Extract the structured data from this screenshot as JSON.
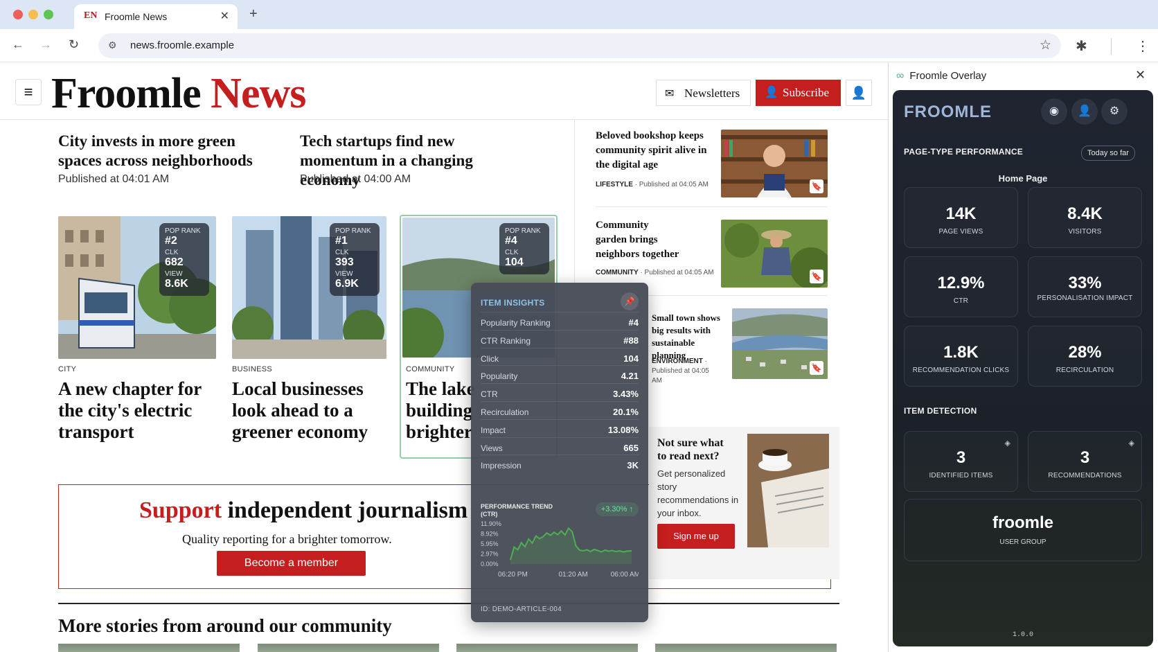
{
  "browser": {
    "tab_favicon": "EN",
    "tab_title": "Froomle News",
    "url": "news.froomle.example",
    "icons": [
      "back-icon",
      "forward-icon",
      "reload-icon",
      "site-settings-icon",
      "star-icon",
      "extensions-icon",
      "menu-icon"
    ]
  },
  "site": {
    "logo_main": "Froomle ",
    "logo_accent": "News",
    "newsletters": "Newsletters",
    "subscribe": "Subscribe",
    "accent": "#c41e1e"
  },
  "top_stories": [
    {
      "title": "City invests in more green spaces across neighborhoods",
      "published": "Published at 04:01 AM"
    },
    {
      "title": "Tech startups find new momentum in a changing economy",
      "published": "Published at 04:00 AM"
    }
  ],
  "cards": [
    {
      "category": "CITY",
      "title": "A new chapter for the city's electric transport",
      "pop_label": "POP RANK",
      "pop": "#2",
      "clk_label": "CLK",
      "clk": "682",
      "view_label": "VIEW",
      "view": "8.6K"
    },
    {
      "category": "BUSINESS",
      "title": "Local businesses look ahead to a greener economy",
      "pop_label": "POP RANK",
      "pop": "#1",
      "clk_label": "CLK",
      "clk": "393",
      "view_label": "VIEW",
      "view": "6.9K"
    },
    {
      "category": "COMMUNITY",
      "title": "The lake building brighter f",
      "pop_label": "POP RANK",
      "pop": "#4",
      "clk_label": "CLK",
      "clk": "104",
      "view_label": "VIEW",
      "view": ""
    }
  ],
  "side_stories": [
    {
      "title": "Beloved bookshop keeps community spirit alive in the digital age",
      "category": "LIFESTYLE",
      "published": " · Published at 04:05 AM"
    },
    {
      "title": "Community garden brings neighbors together",
      "category": "COMMUNITY",
      "published": " · Published at 04:05 AM"
    },
    {
      "title": "Small town shows big results with sustainable planning",
      "category": "ENVIRONMENT",
      "category_suffix": " ·",
      "published": "Published at 04:05 AM"
    }
  ],
  "newsletter_box": {
    "title": "Not sure what to read next?",
    "text": "Get personalized story recommendations in your inbox.",
    "button": "Sign me up"
  },
  "support": {
    "accent_word": "Support",
    "rest": " independent journalism",
    "subtitle": "Quality reporting for a brighter tomorrow.",
    "button": "Become a member"
  },
  "more_heading": "More stories from around our community",
  "insights": {
    "title": "ITEM INSIGHTS",
    "rows": [
      {
        "label": "Popularity Ranking",
        "value": "#4"
      },
      {
        "label": "CTR Ranking",
        "value": "#88"
      },
      {
        "label": "Click",
        "value": "104"
      },
      {
        "label": "Popularity",
        "value": "4.21"
      },
      {
        "label": "CTR",
        "value": "3.43%"
      },
      {
        "label": "Recirculation",
        "value": "20.1%"
      },
      {
        "label": "Impact",
        "value": "13.08%"
      },
      {
        "label": "Views",
        "value": "665"
      },
      {
        "label": "Impression",
        "value": "3K"
      }
    ],
    "trend_title_1": "PERFORMANCE TREND",
    "trend_title_2": "(CTR)",
    "trend_change": "+3.30% ↑",
    "id_label": "ID:  DEMO-ARTICLE-004"
  },
  "chart_data": {
    "type": "area",
    "title": "",
    "xlabel": "",
    "ylabel": "",
    "x_ticks": [
      "06:20 PM",
      "01:20 AM",
      "06:00 AM"
    ],
    "y_ticks": [
      "11.90%",
      "8.92%",
      "5.95%",
      "2.97%",
      "0.00%"
    ],
    "ylim": [
      0,
      11.9
    ],
    "x": [
      0,
      0.03,
      0.06,
      0.09,
      0.12,
      0.15,
      0.18,
      0.21,
      0.24,
      0.27,
      0.3,
      0.33,
      0.36,
      0.39,
      0.42,
      0.45,
      0.48,
      0.51,
      0.54,
      0.57,
      0.6,
      0.63,
      0.66,
      0.69,
      0.72,
      0.75,
      0.78,
      0.81,
      0.84,
      0.87,
      0.9,
      0.93,
      0.96,
      1.0
    ],
    "series": [
      {
        "values": [
          1.2,
          5.0,
          4.2,
          6.3,
          5.1,
          7.4,
          6.2,
          8.3,
          7.5,
          8.1,
          9.2,
          8.5,
          9.4,
          8.7,
          9.8,
          8.6,
          10.6,
          9.5,
          5.4,
          4.1,
          3.9,
          4.2,
          3.7,
          4.3,
          4.0,
          3.6,
          4.1,
          3.8,
          4.0,
          3.7,
          3.9,
          3.6,
          3.8,
          3.9
        ]
      }
    ],
    "color": "#4caf50"
  },
  "overlay": {
    "window_title": "Froomle Overlay",
    "logo": "FROOMLE",
    "section_perf": "PAGE-TYPE PERFORMANCE",
    "period": "Today so far",
    "page_type": "Home Page",
    "metrics": [
      {
        "value": "14K",
        "label": "PAGE VIEWS"
      },
      {
        "value": "8.4K",
        "label": "VISITORS"
      },
      {
        "value": "12.9%",
        "label": "CTR"
      },
      {
        "value": "33%",
        "label": "PERSONALISATION IMPACT"
      },
      {
        "value": "1.8K",
        "label": "RECOMMENDATION CLICKS"
      },
      {
        "value": "28%",
        "label": "RECIRCULATION"
      }
    ],
    "section_detect": "ITEM DETECTION",
    "detection": [
      {
        "value": "3",
        "label": "IDENTIFIED ITEMS"
      },
      {
        "value": "3",
        "label": "RECOMMENDATIONS"
      }
    ],
    "user_group_value": "froomle",
    "user_group_label": "USER GROUP",
    "version": "1.0.0"
  }
}
